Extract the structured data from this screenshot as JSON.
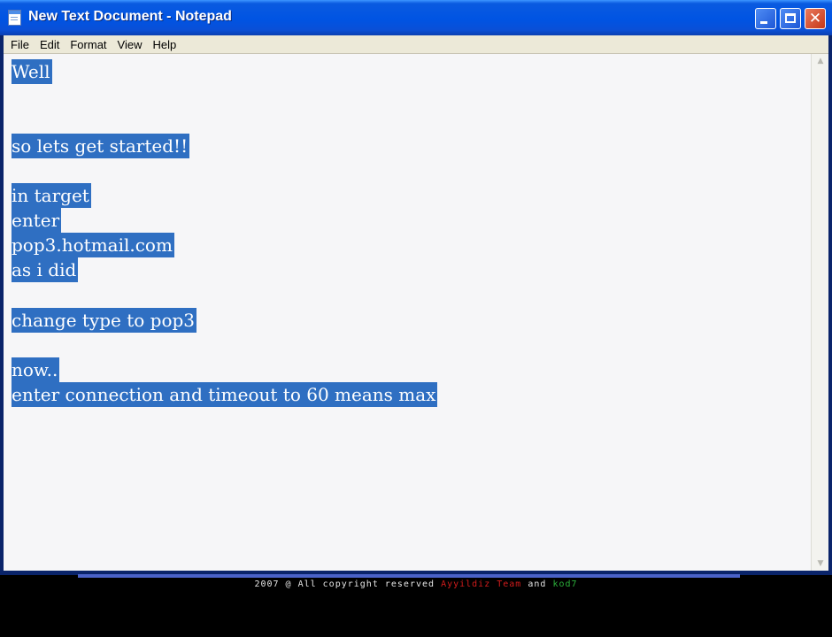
{
  "window": {
    "title": "New Text Document - Notepad",
    "app_icon": "notepad-icon",
    "controls": {
      "minimize": "minimize-icon",
      "maximize": "maximize-icon",
      "close_glyph": "✕"
    }
  },
  "menu": [
    "File",
    "Edit",
    "Format",
    "View",
    "Help"
  ],
  "document": {
    "selection_color": "#2f6fc2",
    "lines": [
      "Well",
      "",
      "",
      "so lets get started!!",
      "",
      "in target",
      "enter",
      "pop3.hotmail.com",
      "as i did",
      "",
      "change type to pop3",
      "",
      "now..",
      "enter connection and timeout to 60 means max"
    ]
  },
  "footer": {
    "prefix": "2007 @ All copyright reserved ",
    "team": "Ayyildiz Team",
    "middle": " and ",
    "author": "kod7",
    "team_color": "#d21c1c",
    "author_color": "#2bb03a"
  }
}
